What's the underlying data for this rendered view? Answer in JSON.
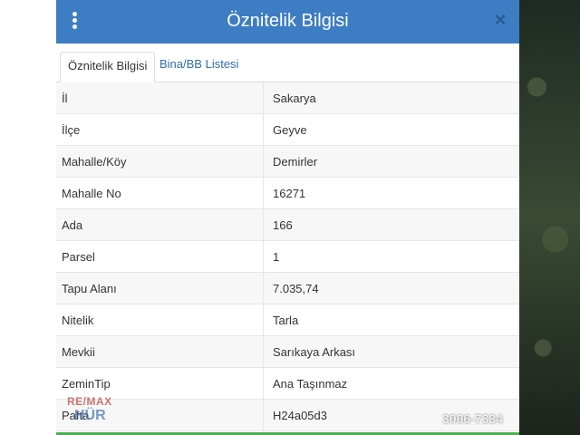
{
  "header": {
    "title": "Öznitelik Bilgisi",
    "close_glyph": "×",
    "accent_color": "#3d7dc3"
  },
  "tabs": [
    {
      "label": "Öznitelik Bilgisi",
      "active": true
    },
    {
      "label": "Bina/BB Listesi",
      "active": false
    }
  ],
  "attributes": [
    {
      "key": "İl",
      "value": "Sakarya"
    },
    {
      "key": "İlçe",
      "value": "Geyve"
    },
    {
      "key": "Mahalle/Köy",
      "value": "Demirler"
    },
    {
      "key": "Mahalle No",
      "value": "16271"
    },
    {
      "key": "Ada",
      "value": "166"
    },
    {
      "key": "Parsel",
      "value": "1"
    },
    {
      "key": "Tapu Alanı",
      "value": "7.035,74"
    },
    {
      "key": "Nitelik",
      "value": "Tarla"
    },
    {
      "key": "Mevkii",
      "value": "Sarıkaya Arkası"
    },
    {
      "key": "ZeminTip",
      "value": "Ana Taşınmaz"
    },
    {
      "key": "Pafta",
      "value": "H24a05d3"
    }
  ],
  "watermark": {
    "logo_line1": "RE/MAX",
    "logo_line2": "HÜR",
    "phone": "3006-7334"
  },
  "icons": {
    "menu": "more-vertical-icon",
    "close": "close-icon"
  }
}
